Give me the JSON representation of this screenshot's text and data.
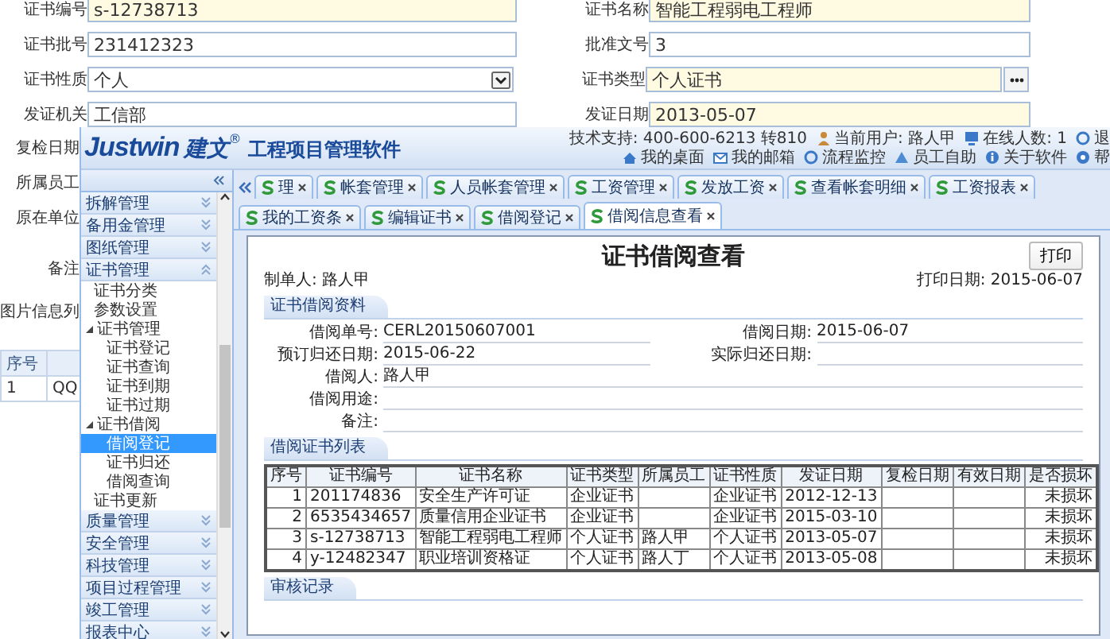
{
  "form": {
    "rows": [
      [
        {
          "label": "证书编号",
          "value": "s-12738713",
          "kind": "text",
          "required": true
        },
        {
          "label": "证书名称",
          "value": "智能工程弱电工程师",
          "kind": "text",
          "required": true
        }
      ],
      [
        {
          "label": "证书批号",
          "value": "231412323",
          "kind": "text",
          "required": false
        },
        {
          "label": "批准文号",
          "value": "3",
          "kind": "text",
          "required": false
        }
      ],
      [
        {
          "label": "证书性质",
          "value": "个人",
          "kind": "select",
          "required": false
        },
        {
          "label": "证书类型",
          "value": "个人证书",
          "kind": "lookup",
          "required": true
        }
      ],
      [
        {
          "label": "发证机关",
          "value": "工信部",
          "kind": "text",
          "required": false
        },
        {
          "label": "发证日期",
          "value": "2013-05-07",
          "kind": "text",
          "required": true
        }
      ]
    ],
    "hidden_labels": [
      "复检日期",
      "所属员工",
      "原在单位",
      "备注",
      "图片信息列"
    ],
    "image_list": {
      "columns": [
        "序号"
      ],
      "rows": [
        [
          "1",
          "QQ"
        ]
      ]
    }
  },
  "app": {
    "logo": {
      "brand": "Justwin",
      "brand_cn": "建文",
      "mark": "®",
      "product": "工程项目管理软件"
    },
    "info": [
      {
        "label": "技术支持: 400-600-6213 转810",
        "kind": "support"
      },
      {
        "label": "当前用户: 路人甲",
        "kind": "user"
      },
      {
        "label": "在线人数: 1",
        "kind": "online"
      },
      {
        "label": "退",
        "kind": "logout"
      }
    ],
    "links": [
      {
        "label": "我的桌面",
        "kind": "home"
      },
      {
        "label": "我的邮箱",
        "kind": "mail"
      },
      {
        "label": "流程监控",
        "kind": "flow"
      },
      {
        "label": "员工自助",
        "kind": "person"
      },
      {
        "label": "关于软件",
        "kind": "info"
      },
      {
        "label": "帮",
        "kind": "help"
      }
    ],
    "sidebar": {
      "groups": [
        {
          "label": "拆解管理",
          "expanded": false
        },
        {
          "label": "备用金管理",
          "expanded": false
        },
        {
          "label": "图纸管理",
          "expanded": false
        },
        {
          "label": "证书管理",
          "expanded": true,
          "children": [
            {
              "label": "证书分类",
              "selected": false
            },
            {
              "label": "参数设置",
              "selected": false
            },
            {
              "label": "证书管理",
              "selected": false,
              "expanded": true,
              "children": [
                {
                  "label": "证书登记",
                  "selected": false
                },
                {
                  "label": "证书查询",
                  "selected": false
                },
                {
                  "label": "证书到期",
                  "selected": false
                },
                {
                  "label": "证书过期",
                  "selected": false
                }
              ]
            },
            {
              "label": "证书借阅",
              "selected": false,
              "expanded": true,
              "children": [
                {
                  "label": "借阅登记",
                  "selected": true
                },
                {
                  "label": "证书归还",
                  "selected": false
                },
                {
                  "label": "借阅查询",
                  "selected": false
                }
              ]
            },
            {
              "label": "证书更新",
              "selected": false
            }
          ]
        },
        {
          "label": "质量管理",
          "expanded": false
        },
        {
          "label": "安全管理",
          "expanded": false
        },
        {
          "label": "科技管理",
          "expanded": false
        },
        {
          "label": "项目过程管理",
          "expanded": false
        },
        {
          "label": "竣工管理",
          "expanded": false
        },
        {
          "label": "报表中心",
          "expanded": false
        }
      ]
    },
    "tabs": [
      {
        "label": "理",
        "selected": false
      },
      {
        "label": "帐套管理",
        "selected": false
      },
      {
        "label": "人员帐套管理",
        "selected": false
      },
      {
        "label": "工资管理",
        "selected": false
      },
      {
        "label": "发放工资",
        "selected": false
      },
      {
        "label": "查看帐套明细",
        "selected": false
      },
      {
        "label": "工资报表",
        "selected": false
      },
      {
        "label": "我的工资条",
        "selected": false
      },
      {
        "label": "编辑证书",
        "selected": false
      },
      {
        "label": "借阅登记",
        "selected": false
      },
      {
        "label": "借阅信息查看",
        "selected": true
      }
    ],
    "document": {
      "title": "证书借阅查看",
      "print_button": "打印",
      "maker": "制单人: 路人甲",
      "print_date": "打印日期: 2015-06-07",
      "sections": [
        {
          "title": "证书借阅资料",
          "kind": "form",
          "fields": [
            {
              "label": "借阅单号:",
              "value": "CERL20150607001",
              "kind": "half"
            },
            {
              "label": "借阅日期:",
              "value": "2015-06-07",
              "kind": "half"
            },
            {
              "label": "预订归还日期:",
              "value": "2015-06-22",
              "kind": "half"
            },
            {
              "label": "实际归还日期:",
              "kind": "half"
            },
            {
              "label": "借阅人:",
              "value": "路人甲",
              "kind": "full"
            },
            {
              "label": "借阅用途:",
              "kind": "full"
            },
            {
              "label": "备注:",
              "kind": "full"
            }
          ]
        },
        {
          "title": "借阅证书列表",
          "kind": "table",
          "columns": [
            "序号",
            "证书编号",
            "证书名称",
            "证书类型",
            "所属员工",
            "证书性质",
            "发证日期",
            "复检日期",
            "有效日期",
            "是否损坏"
          ],
          "rows": [
            [
              "1",
              "201174836",
              "安全生产许可证",
              "企业证书",
              null,
              "企业证书",
              "2012-12-13",
              null,
              null,
              "未损坏"
            ],
            [
              "2",
              "6535434657",
              "质量信用企业证书",
              "企业证书",
              null,
              "企业证书",
              "2015-03-10",
              null,
              null,
              "未损坏"
            ],
            [
              "3",
              "s-12738713",
              "智能工程弱电工程师",
              "个人证书",
              "路人甲",
              "个人证书",
              "2013-05-07",
              null,
              null,
              "未损坏"
            ],
            [
              "4",
              "y-12482347",
              "职业培训资格证",
              "个人证书",
              "路人丁",
              "个人证书",
              "2013-05-08",
              null,
              null,
              "未损坏"
            ]
          ]
        },
        {
          "title": "审核记录",
          "kind": "empty"
        }
      ]
    }
  }
}
